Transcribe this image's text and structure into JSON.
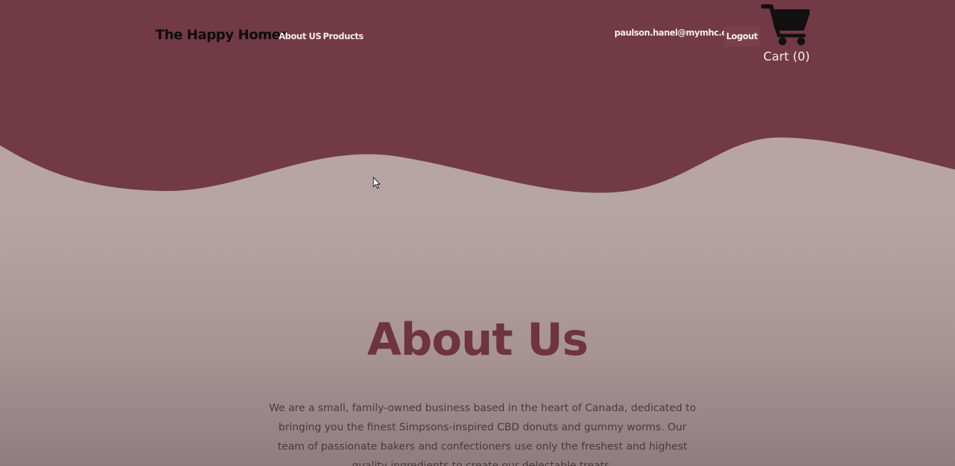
{
  "brand": {
    "name": "The Happy Homer"
  },
  "nav": {
    "about": "About US",
    "products": "Products"
  },
  "user": {
    "email": "paulson.hanel@mymhc.ca",
    "logout_label": "Logout"
  },
  "cart": {
    "label": "Cart (0)",
    "icon": "shopping-cart-icon"
  },
  "about": {
    "title": "About Us",
    "body": "We are a small, family-owned business based in the heart of Canada, dedicated to bringing you the finest Simpsons-inspired CBD donuts and gummy worms. Our team of passionate bakers and confectioners use only the freshest and highest quality ingredients to create our delectable treats."
  },
  "colors": {
    "header_maroon": "#723a46",
    "accent_title": "#6e3440",
    "background_pink": "#b9a5a6"
  }
}
